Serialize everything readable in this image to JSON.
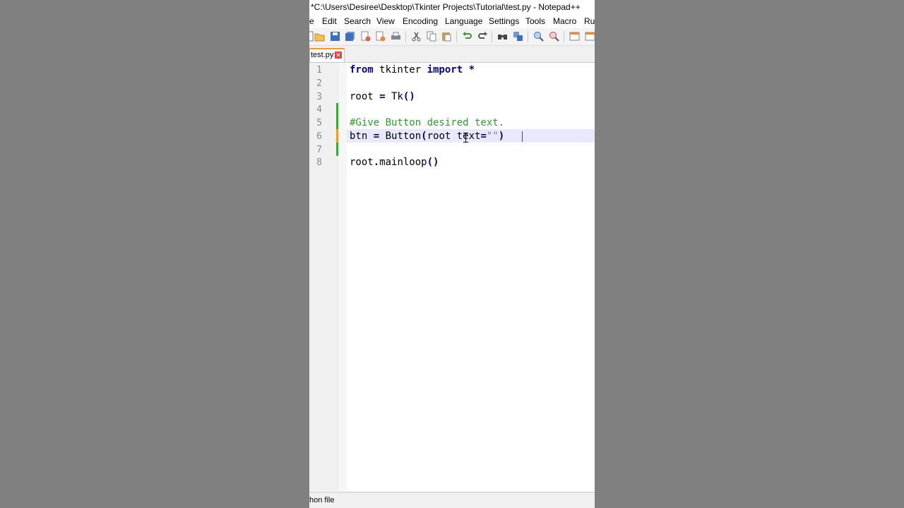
{
  "window": {
    "title": "*C:\\Users\\Desiree\\Desktop\\Tkinter Projects\\Tutorial\\test.py - Notepad++"
  },
  "menu": [
    "e",
    "Edit",
    "Search",
    "View",
    "Encoding",
    "Language",
    "Settings",
    "Tools",
    "Macro",
    "Ru"
  ],
  "toolbar": {
    "icons": [
      "new-file-icon",
      "open-file-icon",
      "save-icon",
      "save-all-icon",
      "close-icon",
      "close-all-icon",
      "print-icon",
      "cut-icon",
      "copy-icon",
      "paste-icon",
      "undo-icon",
      "redo-icon",
      "find-icon",
      "replace-icon",
      "zoom-in-icon",
      "zoom-out-icon",
      "sync-scroll-icon",
      "word-wrap-icon"
    ]
  },
  "tab": {
    "label": "test.py",
    "close": "✕"
  },
  "editor": {
    "line_numbers": [
      "1",
      "2",
      "3",
      "4",
      "5",
      "6",
      "7",
      "8"
    ],
    "lines": {
      "l1": {
        "kw1": "from",
        "t1": " tkinter ",
        "kw2": "import",
        "op1": " *"
      },
      "l3": {
        "t1": "root ",
        "op1": "=",
        "t2": " Tk",
        "op2": "()"
      },
      "l5": {
        "cm": "#Give Button desired text."
      },
      "l6": {
        "t1": "btn ",
        "op1": "=",
        "t2": " Button",
        "op2": "(",
        "t3": "root",
        "t4": " text",
        "op3": "=",
        "st": "\"\"",
        "op4": ")"
      },
      "l8": {
        "t1": "root",
        "op1": ".",
        "t2": "mainloop",
        "op2": "()"
      }
    }
  },
  "statusbar": {
    "text": "hon file"
  },
  "colors": {
    "background": "#808080",
    "keyword": "#0000a0",
    "comment": "#2f9a2f",
    "current_line": "#e8e8ff",
    "change_marker": "#3aa93a",
    "tab_accent": "#f39a2b"
  }
}
